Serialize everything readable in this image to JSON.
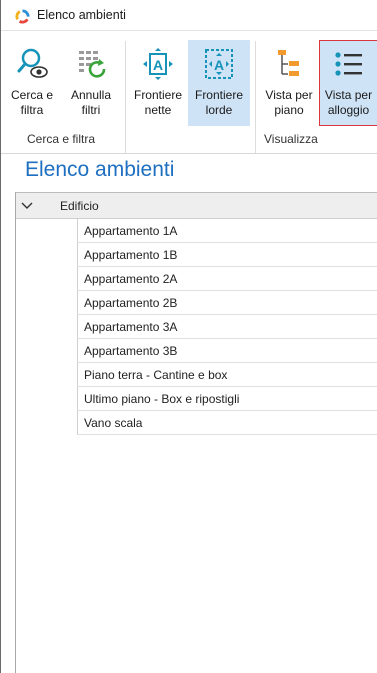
{
  "window": {
    "title": "Elenco ambienti"
  },
  "ribbon": {
    "buttons": [
      {
        "label_line1": "Cerca e",
        "label_line2": "filtra",
        "icon": "search-eye-icon",
        "state": "normal"
      },
      {
        "label_line1": "Annulla",
        "label_line2": "filtri",
        "icon": "clear-filter-icon",
        "state": "normal"
      },
      {
        "label_line1": "Frontiere",
        "label_line2": "nette",
        "icon": "frontier-net-icon",
        "state": "normal"
      },
      {
        "label_line1": "Frontiere",
        "label_line2": "lorde",
        "icon": "frontier-gross-icon",
        "state": "pressed"
      },
      {
        "label_line1": "Vista per",
        "label_line2": "piano",
        "icon": "tree-view-icon",
        "state": "normal"
      },
      {
        "label_line1": "Vista per",
        "label_line2": "alloggio",
        "icon": "list-view-icon",
        "state": "focused"
      }
    ],
    "groups": [
      {
        "label": "Cerca e filtra"
      },
      {
        "label": "Visualizza"
      }
    ]
  },
  "page": {
    "title": "Elenco ambienti"
  },
  "grid": {
    "group_header": "Edificio",
    "rows": [
      "Appartamento 1A",
      "Appartamento 1B",
      "Appartamento 2A",
      "Appartamento 2B",
      "Appartamento 3A",
      "Appartamento 3B",
      "Piano terra - Cantine e box",
      "Ultimo piano - Box e ripostigli",
      "Vano scala"
    ]
  },
  "colors": {
    "accent": "#1e6fc0",
    "pressed_bg": "#cfe3f6",
    "focus_border": "#d9363e",
    "icon_teal": "#1593b8",
    "icon_orange": "#f29a2e"
  }
}
